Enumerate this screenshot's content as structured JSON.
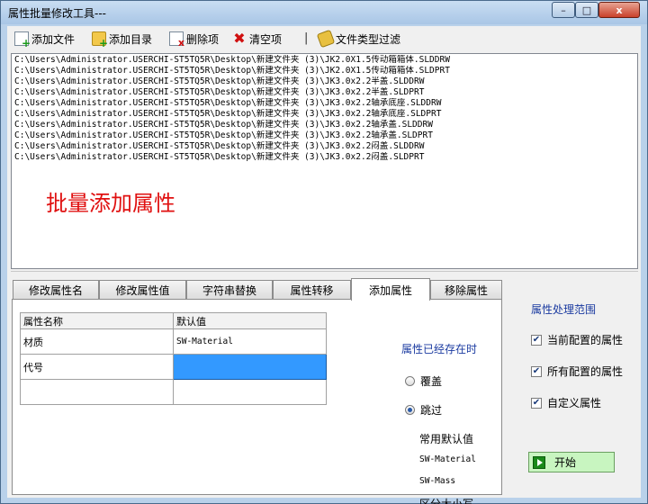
{
  "window": {
    "title": "属性批量修改工具---",
    "minimize": "–",
    "maximize": "□",
    "close": "x"
  },
  "toolbar": {
    "add_file": "添加文件",
    "add_dir": "添加目录",
    "delete": "删除项",
    "clear": "清空项",
    "separator": "|",
    "filter": "文件类型过滤"
  },
  "file_list": {
    "lines": [
      "C:\\Users\\Administrator.USERCHI-ST5TQ5R\\Desktop\\新建文件夹 (3)\\JK2.0X1.5传动箱箱体.SLDDRW",
      "C:\\Users\\Administrator.USERCHI-ST5TQ5R\\Desktop\\新建文件夹 (3)\\JK2.0X1.5传动箱箱体.SLDPRT",
      "C:\\Users\\Administrator.USERCHI-ST5TQ5R\\Desktop\\新建文件夹 (3)\\JK3.0x2.2半盖.SLDDRW",
      "C:\\Users\\Administrator.USERCHI-ST5TQ5R\\Desktop\\新建文件夹 (3)\\JK3.0x2.2半盖.SLDPRT",
      "C:\\Users\\Administrator.USERCHI-ST5TQ5R\\Desktop\\新建文件夹 (3)\\JK3.0x2.2轴承底座.SLDDRW",
      "C:\\Users\\Administrator.USERCHI-ST5TQ5R\\Desktop\\新建文件夹 (3)\\JK3.0x2.2轴承底座.SLDPRT",
      "C:\\Users\\Administrator.USERCHI-ST5TQ5R\\Desktop\\新建文件夹 (3)\\JK3.0x2.2轴承盖.SLDDRW",
      "C:\\Users\\Administrator.USERCHI-ST5TQ5R\\Desktop\\新建文件夹 (3)\\JK3.0x2.2轴承盖.SLDPRT",
      "C:\\Users\\Administrator.USERCHI-ST5TQ5R\\Desktop\\新建文件夹 (3)\\JK3.0x2.2闷盖.SLDDRW",
      "C:\\Users\\Administrator.USERCHI-ST5TQ5R\\Desktop\\新建文件夹 (3)\\JK3.0x2.2闷盖.SLDPRT"
    ],
    "overlay_label": "批量添加属性"
  },
  "tabs": [
    "修改属性名",
    "修改属性值",
    "字符串替换",
    "属性转移",
    "添加属性",
    "移除属性"
  ],
  "grid": {
    "headers": [
      "属性名称",
      "默认值"
    ],
    "rows": [
      [
        "材质",
        "SW-Material"
      ],
      [
        "代号",
        ""
      ],
      [
        "",
        ""
      ]
    ]
  },
  "existing": {
    "title": "属性已经存在时",
    "overwrite": "覆盖",
    "skip": "跳过",
    "common_title": "常用默认值",
    "common_values": [
      "SW-Material",
      "SW-Mass"
    ],
    "case_sensitive": "区分大小写"
  },
  "scope": {
    "title": "属性处理范围",
    "options": [
      "当前配置的属性",
      "所有配置的属性",
      "自定义属性"
    ],
    "start": "开始"
  },
  "colors": {
    "overlay_label": "#e01010",
    "section_title": "#1a3aa0",
    "selected_cell": "#3399ff",
    "start_button": "#c8f5c0"
  }
}
